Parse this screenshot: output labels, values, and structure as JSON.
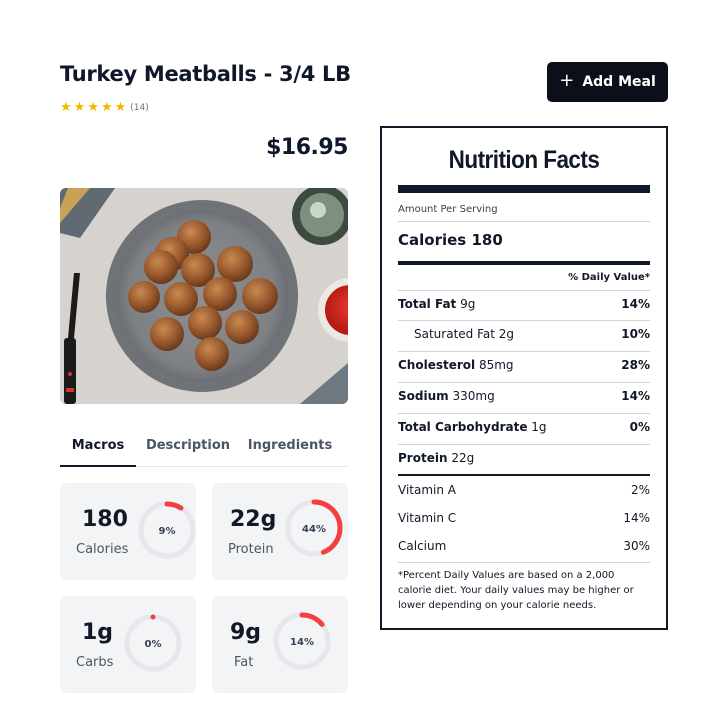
{
  "product": {
    "title": "Turkey Meatballs - 3/4 LB",
    "rating_count": "(14)",
    "stars": 5,
    "price": "$16.95",
    "add_label": "Add Meal"
  },
  "tabs": [
    {
      "label": "Macros",
      "active": true
    },
    {
      "label": "Description",
      "active": false
    },
    {
      "label": "Ingredients",
      "active": false
    }
  ],
  "macros": [
    {
      "value": "180",
      "label": "Calories",
      "pct": "9%",
      "fraction": 0.09
    },
    {
      "value": "22g",
      "label": "Protein",
      "pct": "44%",
      "fraction": 0.44
    },
    {
      "value": "1g",
      "label": "Carbs",
      "pct": "0%",
      "fraction": 0.0
    },
    {
      "value": "9g",
      "label": "Fat",
      "pct": "14%",
      "fraction": 0.14
    }
  ],
  "nutrition": {
    "title": "Nutrition Facts",
    "amount_per_serving": "Amount Per Serving",
    "calories_label": "Calories 180",
    "daily_value_header": "% Daily Value*",
    "rows": [
      {
        "name": "Total Fat",
        "amount": "9g",
        "dv": "14%"
      },
      {
        "name": "Saturated Fat",
        "amount": "2g",
        "dv": "10%"
      },
      {
        "name": "Cholesterol",
        "amount": "85mg",
        "dv": "28%"
      },
      {
        "name": "Sodium",
        "amount": "330mg",
        "dv": "14%"
      },
      {
        "name": "Total Carbohydrate",
        "amount": "1g",
        "dv": "0%"
      },
      {
        "name": "Protein",
        "amount": "22g",
        "dv": ""
      }
    ],
    "vitamins": [
      {
        "name": "Vitamin A",
        "dv": "2%"
      },
      {
        "name": "Vitamin C",
        "dv": "14%"
      },
      {
        "name": "Calcium",
        "dv": "30%"
      }
    ],
    "footnote": "*Percent Daily Values are based on a 2,000 calorie diet. Your daily values may be higher or lower depending on your calorie needs."
  },
  "colors": {
    "accent": "#f43f3f",
    "ring_track": "#e5e7eb",
    "button_bg": "#0b0f19",
    "star": "#f5b800"
  }
}
